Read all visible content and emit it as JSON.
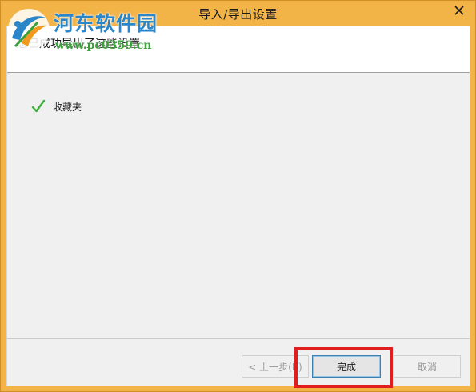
{
  "window": {
    "title": "导入/导出设置"
  },
  "watermark": {
    "site_name": "河东软件园",
    "site_url": "www.pc0359.cn"
  },
  "header": {
    "message": "您已成功导出了这些设置"
  },
  "results": [
    {
      "label": "收藏夹",
      "status": "success"
    }
  ],
  "buttons": {
    "back_label": "< 上一步(B)",
    "finish_label": "完成",
    "cancel_label": "取消"
  },
  "colors": {
    "title_bar": "#f2b347",
    "highlight": "#e01e1e",
    "check": "#3cae3c",
    "watermark_name": "#2a86c8",
    "watermark_url": "#3aa03a"
  }
}
